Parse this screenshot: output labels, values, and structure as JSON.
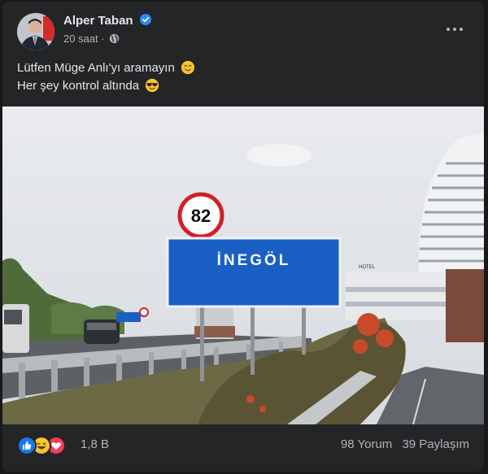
{
  "post": {
    "author": "Alper Taban",
    "time": "20 saat",
    "lines": [
      "Lütfen Müge Anlı'yı aramayın",
      "Her şey kontrol altında"
    ],
    "sign": {
      "speed_limit": "82",
      "city": "İNEGÖL",
      "hotel_label": "HOTEL"
    },
    "reactions": {
      "icons": [
        "like-icon",
        "haha-icon",
        "love-icon"
      ],
      "count": "1,8 B",
      "comments": "98 Yorum",
      "shares": "39 Paylaşım"
    }
  },
  "colors": {
    "background": "#18191a",
    "card": "#242526",
    "primary_text": "#e4e6eb",
    "secondary_text": "#b0b3b8",
    "verified": "#2d88ff",
    "sign_blue": "#1a5fc4"
  }
}
